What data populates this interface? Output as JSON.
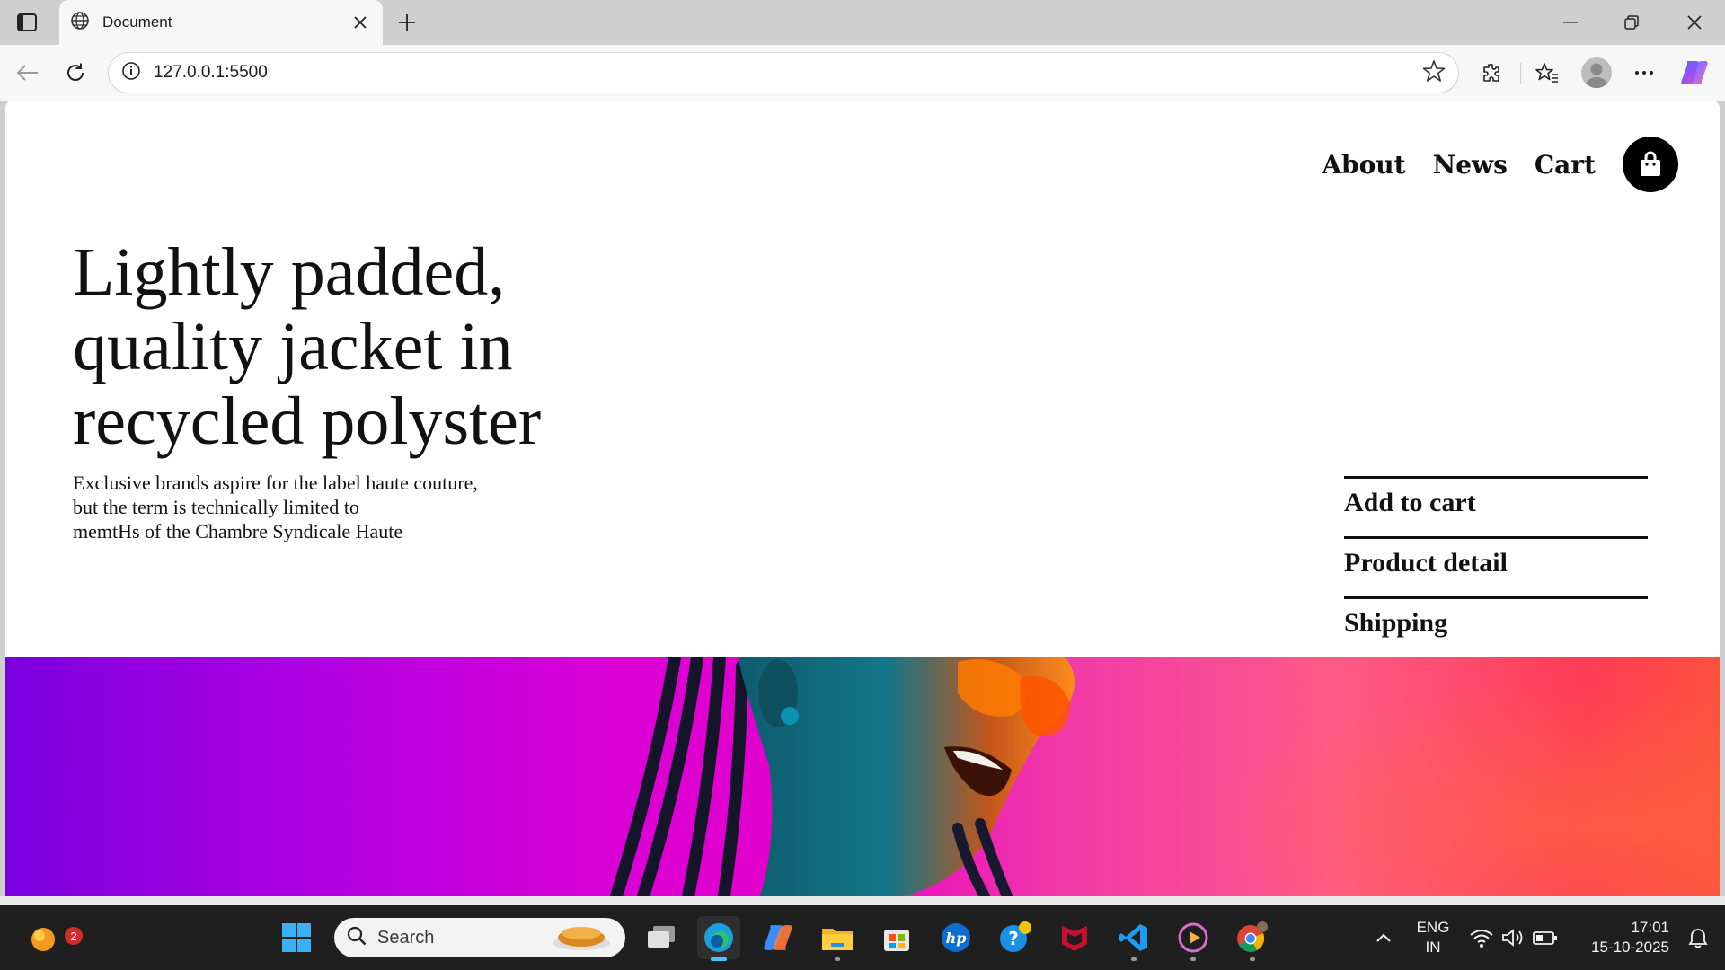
{
  "browser": {
    "tab_title": "Document",
    "url": "127.0.0.1:5500",
    "icons": [
      "tab-actions-icon",
      "globe-icon",
      "close-icon",
      "plus-icon",
      "minimize-icon",
      "restore-icon",
      "close-window-icon",
      "back-arrow-icon",
      "refresh-icon",
      "info-icon",
      "star-icon",
      "extensions-icon",
      "favorites-icon",
      "profile-icon",
      "more-icon",
      "copilot-icon"
    ]
  },
  "page": {
    "nav": {
      "about": "About",
      "news": "News",
      "cart": "Cart",
      "cart_icon": "shopping-bag-icon"
    },
    "hero": {
      "title": "Lightly padded, quality jacket in recycled polyster",
      "desc_line1": "Exclusive brands aspire for the label haute couture,",
      "desc_line2": "but the term is technically limited to",
      "desc_line3": "memtHs of the Chambre Syndicale Haute"
    },
    "side_links": {
      "add_to_cart": "Add to cart",
      "product_detail": "Product detail",
      "shipping": "Shipping"
    },
    "banner": {
      "description_icon": "model-photo",
      "gradient": [
        "#7a00e0",
        "#d800d8",
        "#ff5a86",
        "#ff3c56"
      ]
    }
  },
  "taskbar": {
    "notification_count": "2",
    "search_placeholder": "Search",
    "apps": [
      "start",
      "search",
      "task-view",
      "edge",
      "copilot",
      "file-explorer",
      "store",
      "hp",
      "help",
      "mcafee",
      "vscode",
      "media-player",
      "chrome"
    ],
    "lang_line1": "ENG",
    "lang_line2": "IN",
    "time": "17:01",
    "date": "15-10-2025"
  }
}
